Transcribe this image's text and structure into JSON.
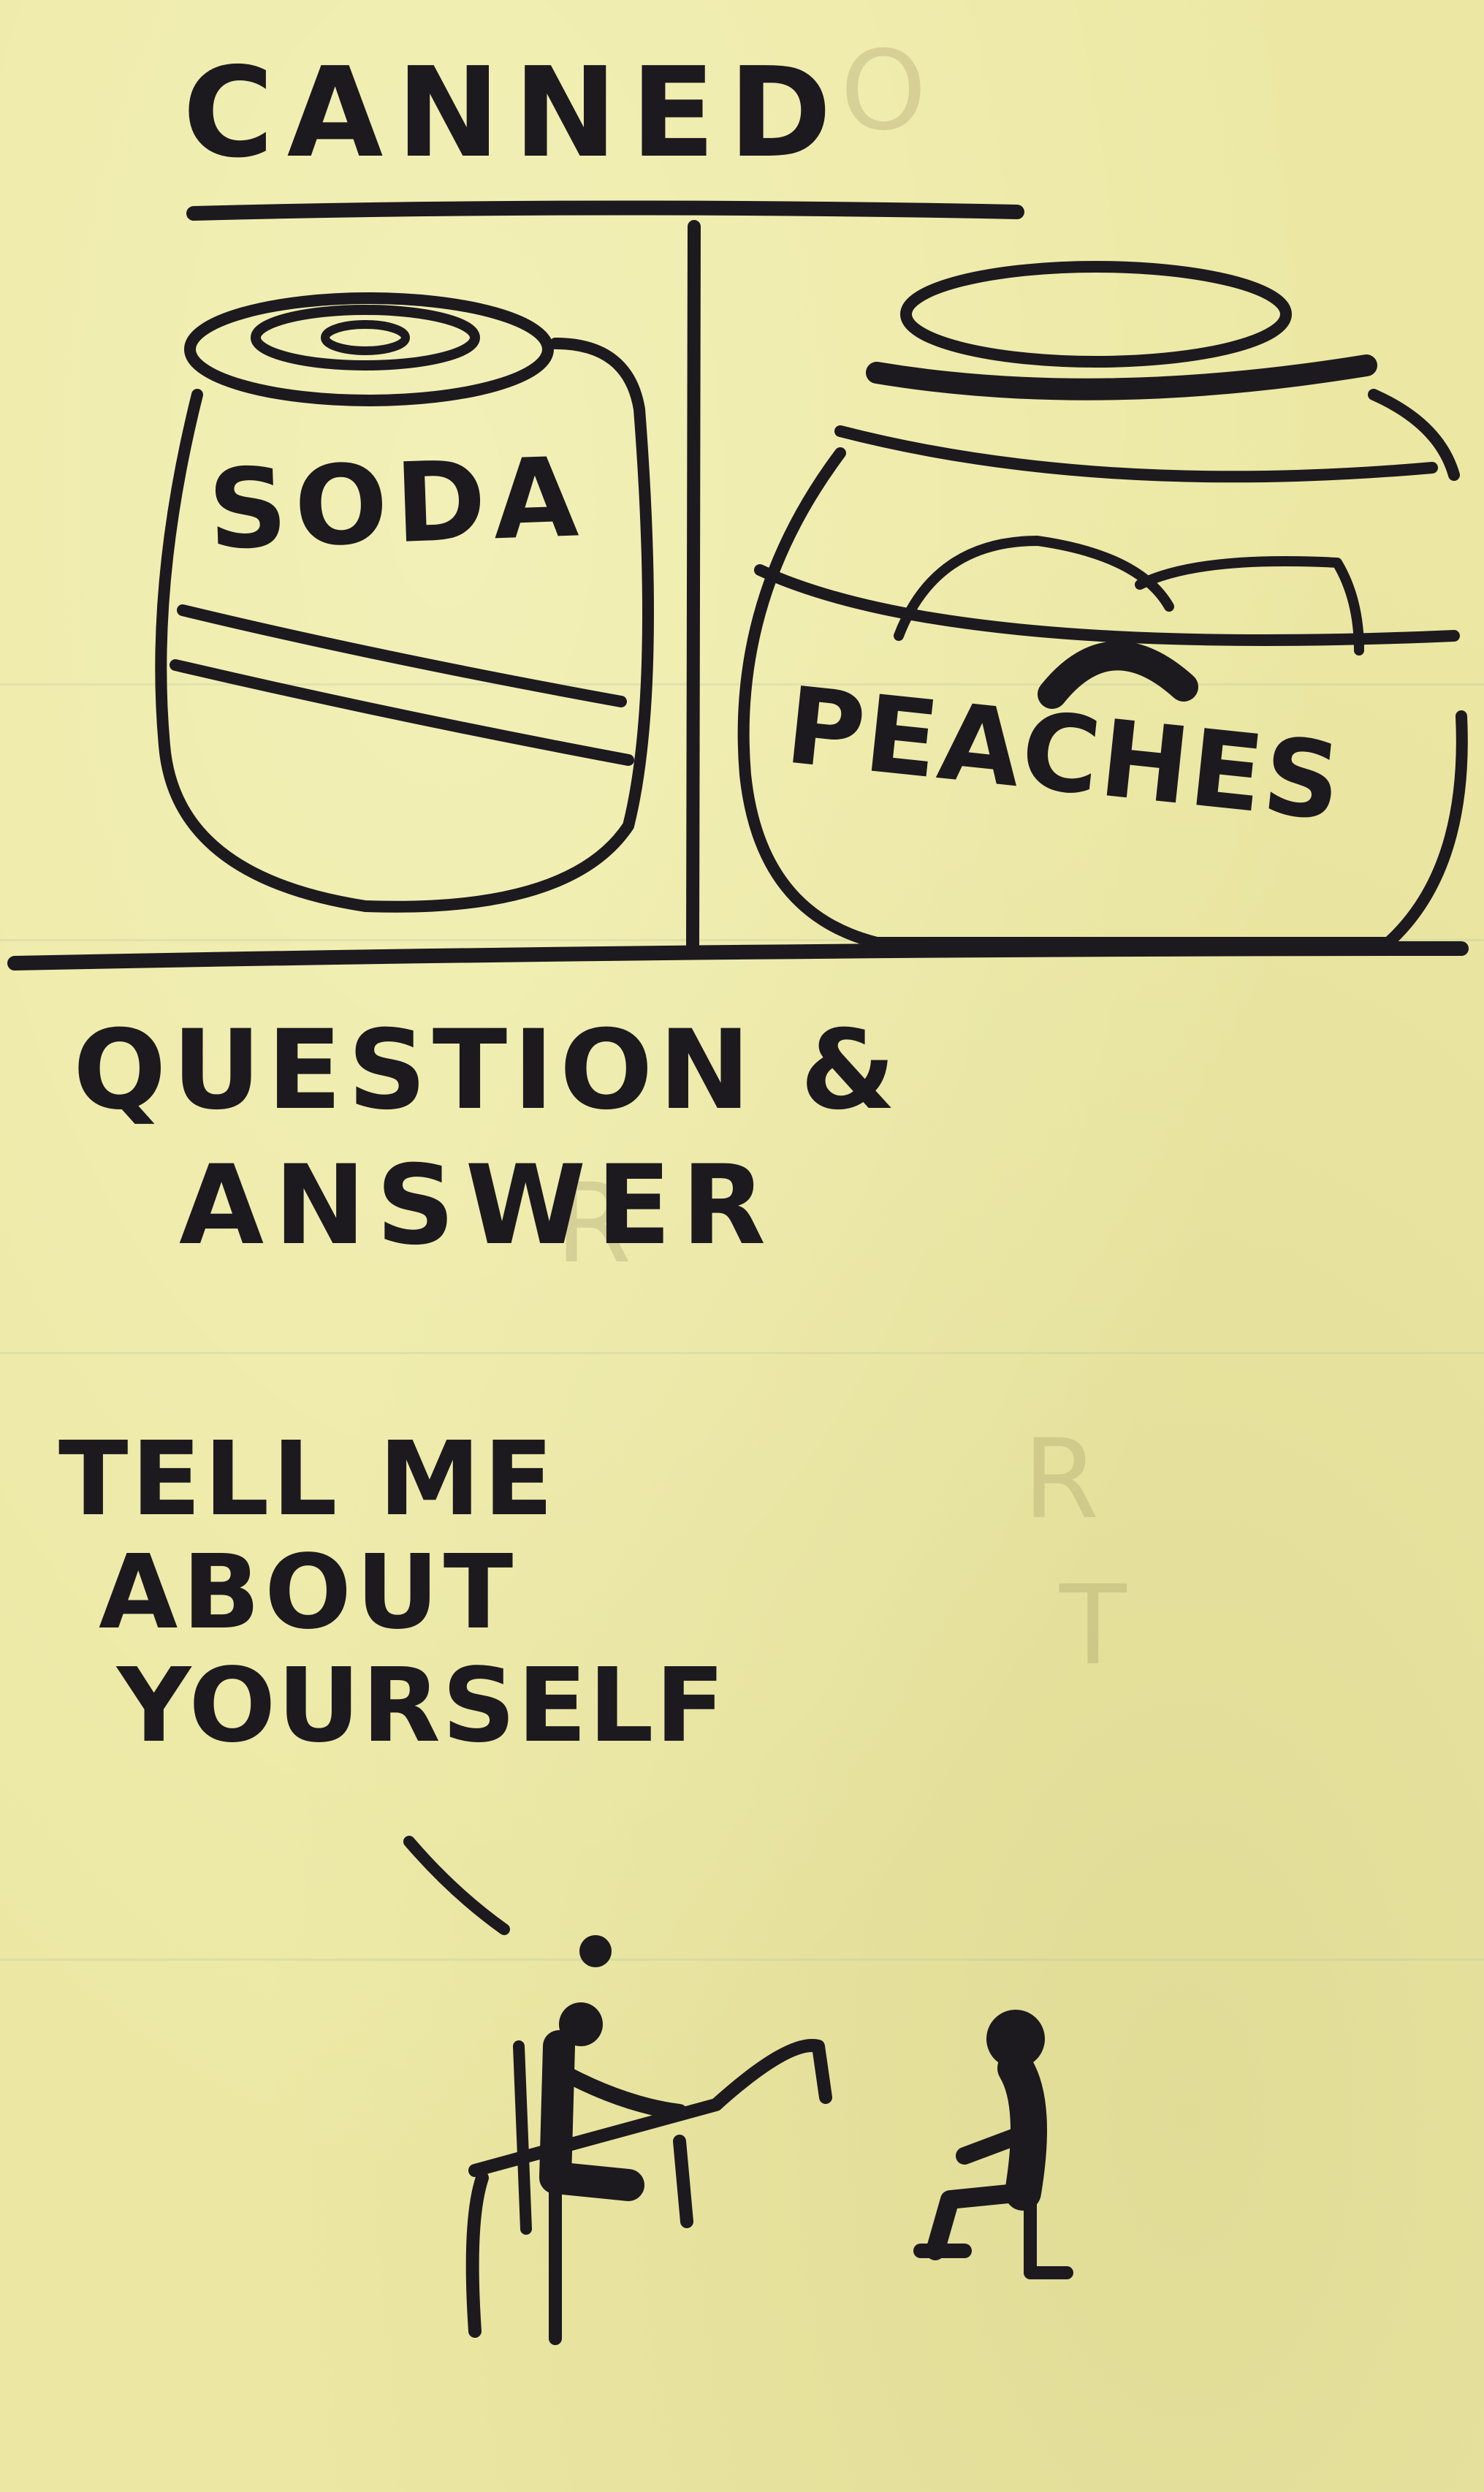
{
  "card": {
    "background_color": "#ece8a4",
    "ink_color": "#1c1a1e"
  },
  "top_panel": {
    "title": "CANNED",
    "left_can_label": "SODA",
    "right_can_label": "PEACHES"
  },
  "bottom_panel": {
    "title_line1": "QUESTION &",
    "title_line2": "ANSWER",
    "speech_line1": "TELL ME",
    "speech_line2": "ABOUT",
    "speech_line3": "YOURSELF"
  },
  "icons": {
    "soda_can": "soda-can-icon",
    "peach_jar": "peach-jar-icon",
    "interviewer": "seated-person-at-desk-icon",
    "interviewee": "seated-person-icon"
  }
}
